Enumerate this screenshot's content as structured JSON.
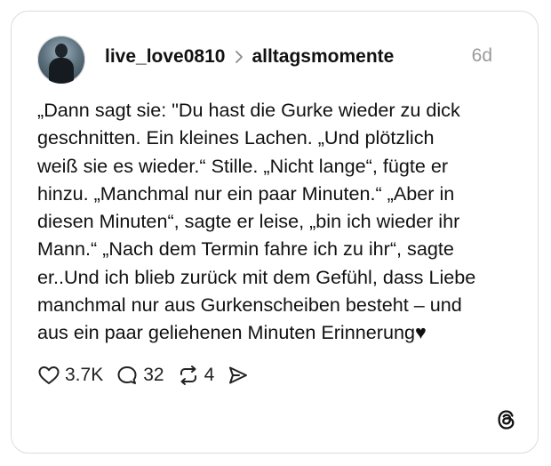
{
  "post": {
    "author": "live_love0810",
    "community": "alltagsmomente",
    "time": "6d",
    "text": "„Dann sagt sie: \"Du hast die Gurke wieder zu dick\ngeschnitten. Ein kleines Lachen. „Und plötzlich\nweiß sie es wieder.“ Stille. „Nicht lange“, fügte er\nhinzu. „Manchmal nur ein paar Minuten.“ „Aber in\ndiesen Minuten“, sagte er leise, „bin ich wieder ihr\nMann.“ „Nach dem Termin fahre ich zu ihr“, sagte\ner..Und ich blieb zurück mit dem Gefühl, dass Liebe\nmanchmal nur aus Gurkenscheiben besteht – und\naus ein paar geliehenen Minuten Erinnerung♥"
  },
  "actions": {
    "likes": "3.7K",
    "comments": "32",
    "reposts": "4"
  },
  "icons": {
    "like": "heart-icon",
    "comment": "comment-bubble-icon",
    "repost": "repost-icon",
    "share": "send-icon",
    "brand": "threads-logo-icon"
  }
}
